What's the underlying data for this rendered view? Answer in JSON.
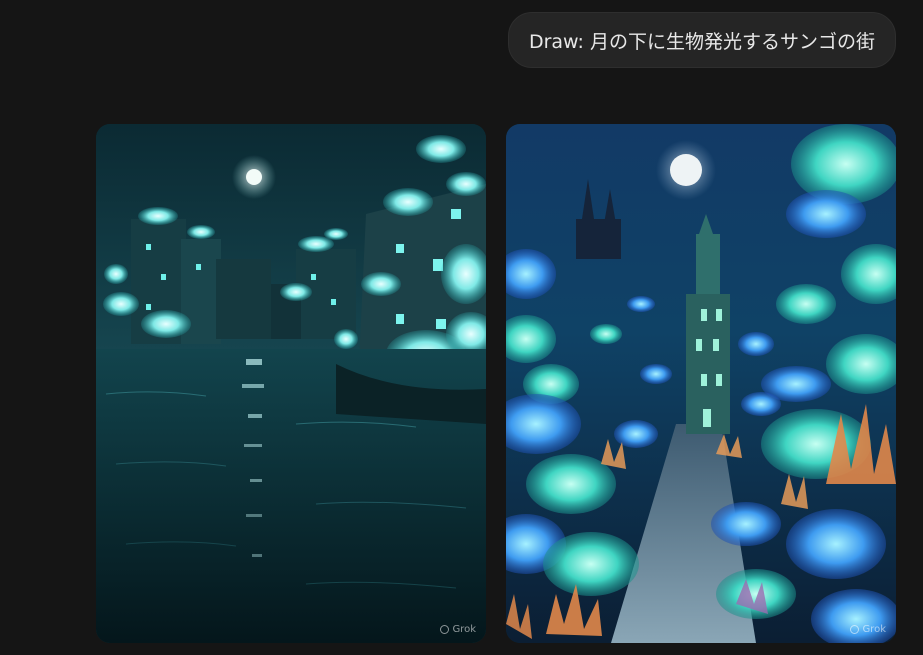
{
  "conversation": {
    "user_message": "Draw: 月の下に生物発光するサンゴの街"
  },
  "generated_images": [
    {
      "watermark": "Grok"
    },
    {
      "watermark": "Grok"
    }
  ],
  "colors": {
    "page_background": "#151515",
    "bubble_background": "#252525",
    "bubble_text": "#e8e8e8",
    "coral_glow": "#5fe3e0",
    "coral_orange": "#e0874a"
  }
}
